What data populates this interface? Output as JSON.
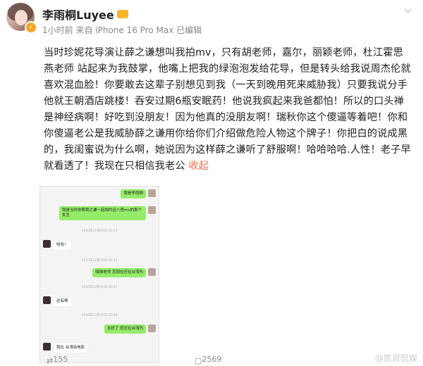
{
  "user": {
    "name": "李雨桐Luyee",
    "meta": "1小时前  来自 iPhone 16 Pro Max 已编辑"
  },
  "post": {
    "text": "当时珍妮花导演让薛之谦想叫我拍mv，只有胡老师，嘉尔，丽颖老师，杜江霍思燕老师 站起来为我鼓掌，他嘴上把我的绿泡泡发给花导，但是转头给我说周杰伦就喜欢混血脸！你要敢去这辈子别想见到我（一天到晚用死来威胁我）只要我说分手 他就王朝酒店跳楼！吞安过期6瓶安眠药！他说我疯起来我爸都怕！所以的口头禅是神经病啊！好吃到没朋友！因为他真的没朋友啊！瑞秋你这个傻逼等着吧！你和你傻逼老公是我威胁薛之谦用你给你们介绍做危险人物这个牌子！你把白的说成黑的，我闺蜜说为什么啊，她说因为这样薛之谦听了舒服啊！哈哈哈哈.人性！老子早就看透了！我现在只相信我老公",
    "fold_label": "收起"
  },
  "chat": {
    "messages": [
      {
        "side": "me",
        "text": "我是李雨桐"
      },
      {
        "side": "them_in_me",
        "text": "我是当时你帮我之谦一起相约且八怪mv的那个女生"
      },
      {
        "side": "ts",
        "text": "2020年11月03日 10:13"
      },
      {
        "side": "them",
        "text": "哈哈！"
      },
      {
        "side": "ts",
        "text": "2020年12月10日 09:32"
      },
      {
        "side": "me",
        "text": "嗨嗨老师 您现在还在台湾吗"
      },
      {
        "side": "ts",
        "text": "2020年12月11日 10:22"
      },
      {
        "side": "them",
        "text": "还有啊"
      },
      {
        "side": "ts",
        "text": "2020年12月15日 15:08"
      },
      {
        "side": "me",
        "text": "太好了 您还在台湾吗"
      },
      {
        "side": "them",
        "text": "我在 台湾拍电影"
      }
    ]
  },
  "footer": {
    "reposts": "155",
    "comments": "2569",
    "watermark": "@凯哥侃娱"
  }
}
